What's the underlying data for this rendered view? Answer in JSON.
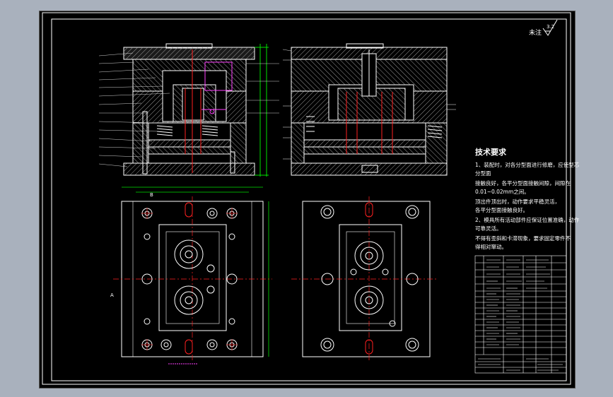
{
  "drawing": {
    "roughness_note": "未注",
    "roughness_value": "3.2",
    "tech_req": {
      "title": "技术要求",
      "lines": [
        "1、装配时，对各分型面进行修磨，应使型芯",
        "分型面",
        "接触良好，各平分型面接触间隙，间隙在",
        "0.01~0.02mm之间。",
        "顶出件顶出时，动作要求平稳灵活，",
        "各平分型面接触良好。",
        "2、模具所有活动部件应保证位置准确，动作",
        "可靠灵活。",
        "不得有歪斜和卡滞现象，要求固定零件不",
        "得相对窜动。"
      ]
    },
    "colors": {
      "background": "#000000",
      "frame": "#ffffff",
      "outline": "#ffffff",
      "centerline": "#ff2020",
      "dimension": "#00e000",
      "hidden": "#ffff00",
      "magenta": "#ff40ff",
      "cyan": "#40e0ff"
    },
    "view_labels": {
      "a": "A",
      "b": "B"
    }
  }
}
